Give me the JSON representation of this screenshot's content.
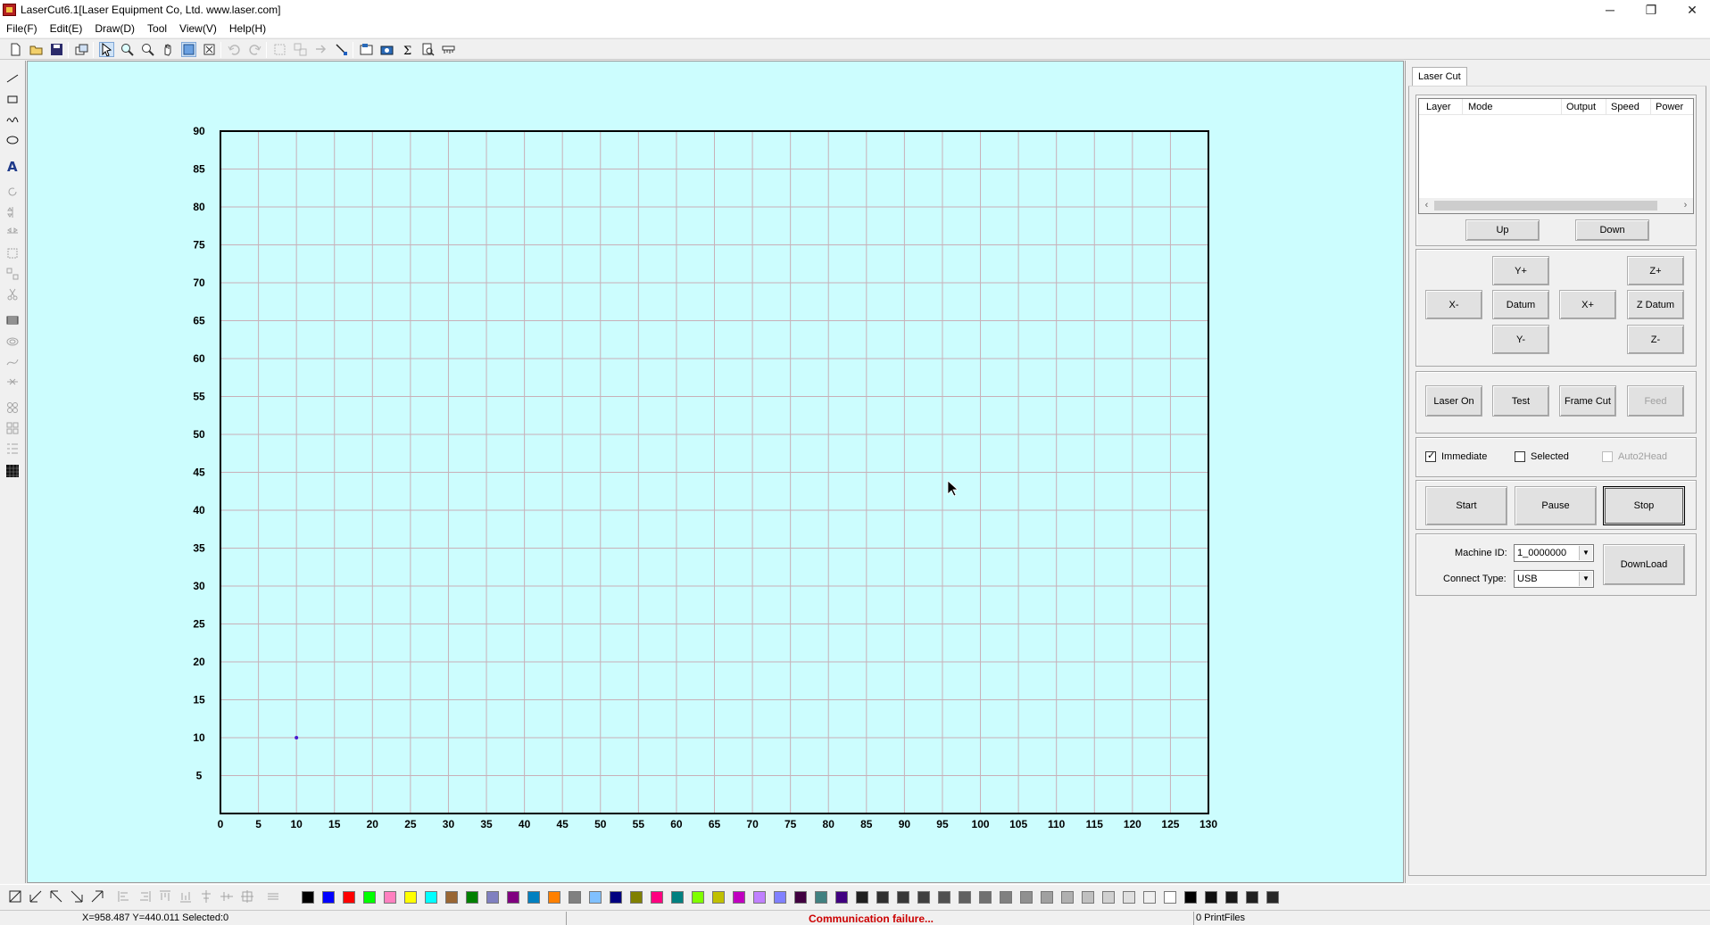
{
  "window": {
    "title": "LaserCut6.1[Laser Equipment Co, Ltd. www.laser.com]",
    "controls": {
      "minimize": "─",
      "maximize": "❐",
      "close": "✕"
    }
  },
  "menu": [
    "File(F)",
    "Edit(E)",
    "Draw(D)",
    "Tool",
    "View(V)",
    "Help(H)"
  ],
  "toolbar_icons": [
    "new-file-icon",
    "open-folder-icon",
    "save-icon",
    "import-icon",
    "select-icon",
    "zoom-in-icon",
    "zoom-fit-icon",
    "pan-hand-icon",
    "view-page-icon",
    "view-data-icon",
    "undo-icon",
    "redo-icon",
    "group-icon",
    "ungroup-icon",
    "arrow-icon",
    "node-edit-icon",
    "parameter-icon",
    "camera-icon",
    "sum-icon",
    "preview-icon",
    "ruler-icon"
  ],
  "left_tools": [
    "line-tool-icon",
    "rectangle-tool-icon",
    "curve-tool-icon",
    "ellipse-tool-icon",
    "text-tool-icon",
    "rotate-icon",
    "mirror-vertical-icon",
    "mirror-horizontal-icon",
    "scale-icon",
    "array-icon",
    "cut-icon",
    "fill-icon",
    "offset-icon",
    "smooth-icon",
    "join-icon",
    "bitmap-icon",
    "distribute-icon",
    "align-icon",
    "grid-array-icon"
  ],
  "chart_data": {
    "type": "grid",
    "title": "",
    "x_ticks": [
      0,
      5,
      10,
      15,
      20,
      25,
      30,
      35,
      40,
      45,
      50,
      55,
      60,
      65,
      70,
      75,
      80,
      85,
      90,
      95,
      100,
      105,
      110,
      115,
      120,
      125,
      130
    ],
    "y_ticks": [
      5,
      10,
      15,
      20,
      25,
      30,
      35,
      40,
      45,
      50,
      55,
      60,
      65,
      70,
      75,
      80,
      85,
      90
    ],
    "xlim": [
      0,
      130
    ],
    "ylim": [
      0,
      90
    ],
    "grid": true,
    "points": [
      {
        "x": 10,
        "y": 10,
        "color": "#4a1ad0"
      }
    ],
    "background": "#ccfdfe"
  },
  "panel": {
    "tab": "Laser Cut",
    "layer_columns": [
      "Layer",
      "Mode",
      "Output",
      "Speed",
      "Power"
    ],
    "up": "Up",
    "down": "Down",
    "jog": {
      "y_plus": "Y+",
      "x_minus": "X-",
      "datum": "Datum",
      "x_plus": "X+",
      "y_minus": "Y-",
      "z_plus": "Z+",
      "z_datum": "Z Datum",
      "z_minus": "Z-"
    },
    "laser_on": "Laser On",
    "test": "Test",
    "frame_cut": "Frame Cut",
    "feed": "Feed",
    "immediate": "Immediate",
    "selected": "Selected",
    "auto2head": "Auto2Head",
    "start": "Start",
    "pause": "Pause",
    "stop": "Stop",
    "machine_id_label": "Machine ID:",
    "machine_id": "1_0000000",
    "connect_type_label": "Connect Type:",
    "connect_type": "USB",
    "download": "DownLoad"
  },
  "palette": [
    "#000000",
    "#0000ff",
    "#ff0000",
    "#00ff00",
    "#ff80c0",
    "#ffff00",
    "#00ffff",
    "#996633",
    "#008000",
    "#8080c0",
    "#800080",
    "#0080c0",
    "#ff8000",
    "#808080",
    "#80c0ff",
    "#000080",
    "#808000",
    "#ff0080",
    "#008080",
    "#80ff00",
    "#c0c000",
    "#c000c0",
    "#c080ff",
    "#8080ff",
    "#400040",
    "#408080",
    "#400080",
    "#202020",
    "#303030",
    "#383838",
    "#404040",
    "#505050",
    "#606060",
    "#707070",
    "#808080",
    "#909090",
    "#a0a0a0",
    "#b0b0b0",
    "#c0c0c0",
    "#d0d0d0",
    "#e0e0e0",
    "#f0f0f0",
    "#ffffff",
    "#000000",
    "#101010",
    "#181818",
    "#202020",
    "#282828"
  ],
  "status": {
    "coords": "X=958.487 Y=440.011 Selected:0",
    "message": "Communication failure...",
    "files": "0 PrintFiles",
    "message_color": "#cc0000"
  }
}
